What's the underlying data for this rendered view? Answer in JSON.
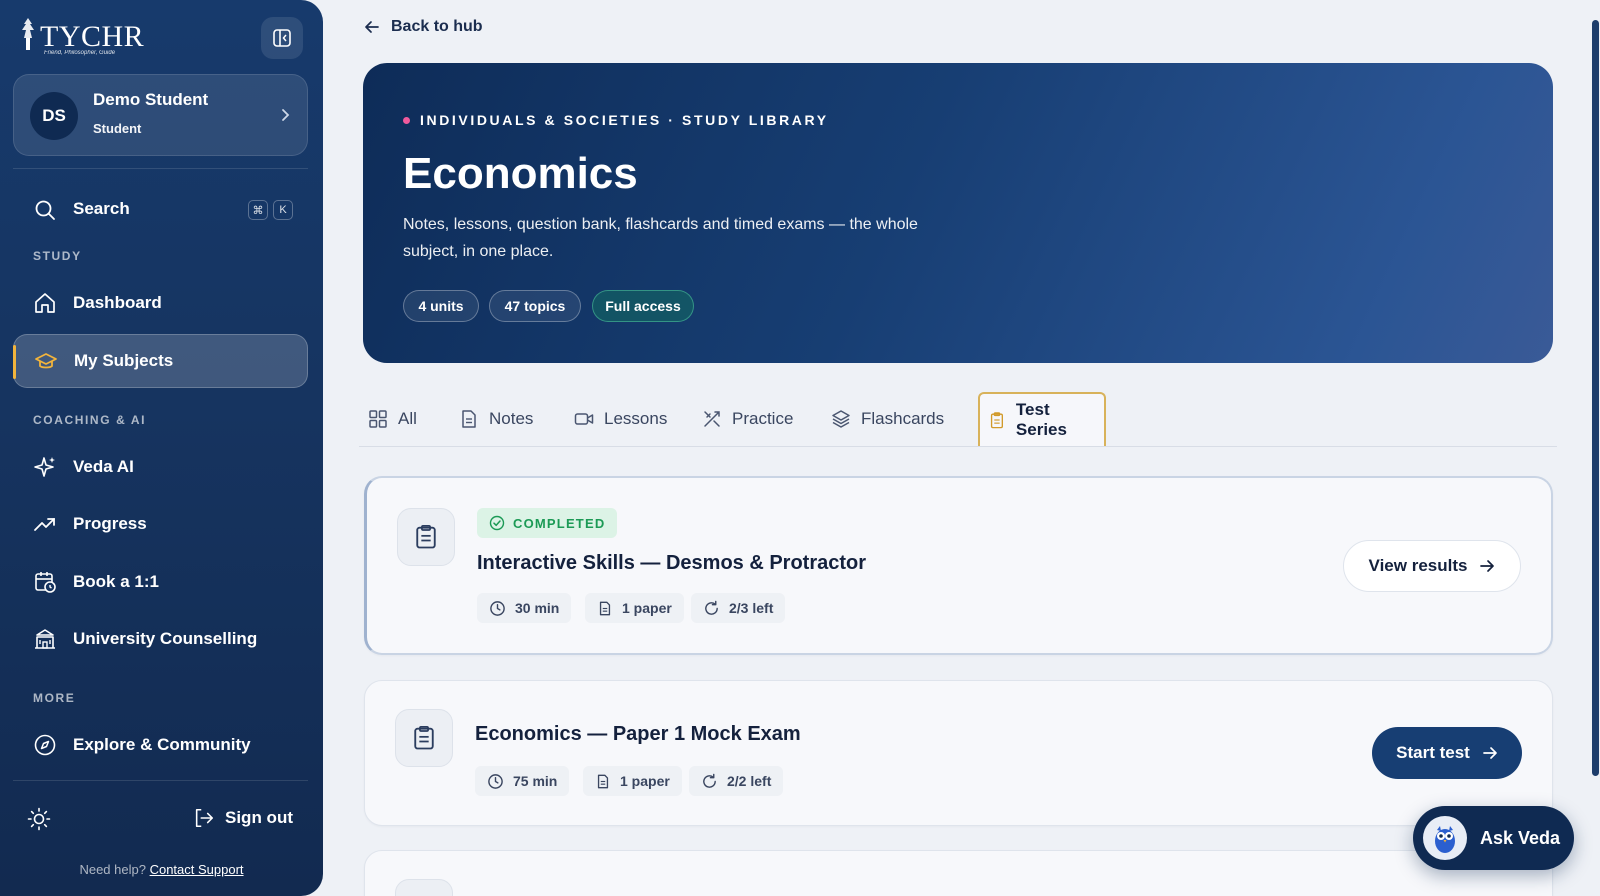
{
  "app": {
    "logo_text": "TYCHR",
    "logo_tagline": "Friend, Philosopher, Guide"
  },
  "user": {
    "initials": "DS",
    "name": "Demo Student",
    "role": "Student"
  },
  "search": {
    "label": "Search",
    "shortcut_keys": [
      "⌘",
      "K"
    ]
  },
  "sidebar": {
    "sections": {
      "study": "STUDY",
      "coaching": "COACHING & AI",
      "more": "MORE"
    },
    "items": [
      {
        "label": "Dashboard",
        "icon": "home-icon",
        "active": false
      },
      {
        "label": "My Subjects",
        "icon": "graduation-cap-icon",
        "active": true
      },
      {
        "label": "Veda AI",
        "icon": "sparkle-icon",
        "active": false
      },
      {
        "label": "Progress",
        "icon": "trend-up-icon",
        "active": false
      },
      {
        "label": "Book a 1:1",
        "icon": "calendar-clock-icon",
        "active": false
      },
      {
        "label": "University Counselling",
        "icon": "school-building-icon",
        "active": false
      },
      {
        "label": "Explore & Community",
        "icon": "compass-icon",
        "active": false
      }
    ],
    "sign_out": "Sign out",
    "help_text": "Need help?",
    "help_link": "Contact Support"
  },
  "back_link": "Back to hub",
  "hero": {
    "eyebrow": "INDIVIDUALS & SOCIETIES · STUDY LIBRARY",
    "title": "Economics",
    "description": "Notes, lessons, question bank, flashcards and timed exams — the whole subject, in one place.",
    "chips": [
      "4 units",
      "47 topics",
      "Full access"
    ]
  },
  "tabs": [
    {
      "label": "All",
      "icon": "grid-icon",
      "active": false
    },
    {
      "label": "Notes",
      "icon": "document-icon",
      "active": false
    },
    {
      "label": "Lessons",
      "icon": "video-icon",
      "active": false
    },
    {
      "label": "Practice",
      "icon": "tools-icon",
      "active": false
    },
    {
      "label": "Flashcards",
      "icon": "layers-icon",
      "active": false
    },
    {
      "label": "Test Series",
      "icon": "clipboard-icon",
      "active": true
    }
  ],
  "tests": [
    {
      "status": "COMPLETED",
      "title": "Interactive Skills — Desmos & Protractor",
      "duration": "30 min",
      "papers": "1 paper",
      "attempts": "2/3 left",
      "action": "View results"
    },
    {
      "status": "",
      "title": "Economics — Paper 1 Mock Exam",
      "duration": "75 min",
      "papers": "1 paper",
      "attempts": "2/2 left",
      "action": "Start test"
    }
  ],
  "ask_veda": "Ask Veda",
  "colors": {
    "sidebar_bg": "#163460",
    "accent_gold": "#f2b43c",
    "primary_button": "#173e73",
    "status_green": "#1b9a55",
    "eyebrow_dot": "#f05a9c"
  }
}
